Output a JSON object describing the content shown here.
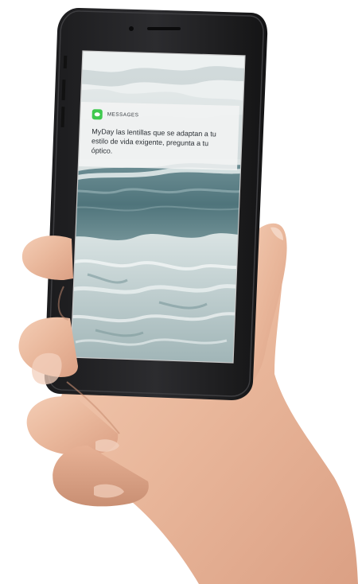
{
  "notification": {
    "app_name": "MESSAGES",
    "message": "MyDay las lentillas que se adaptan a tu estilo de vida exigente, pregunta a tu óptico.",
    "icon": "messages-app-icon",
    "icon_color": "#3ec94e"
  }
}
